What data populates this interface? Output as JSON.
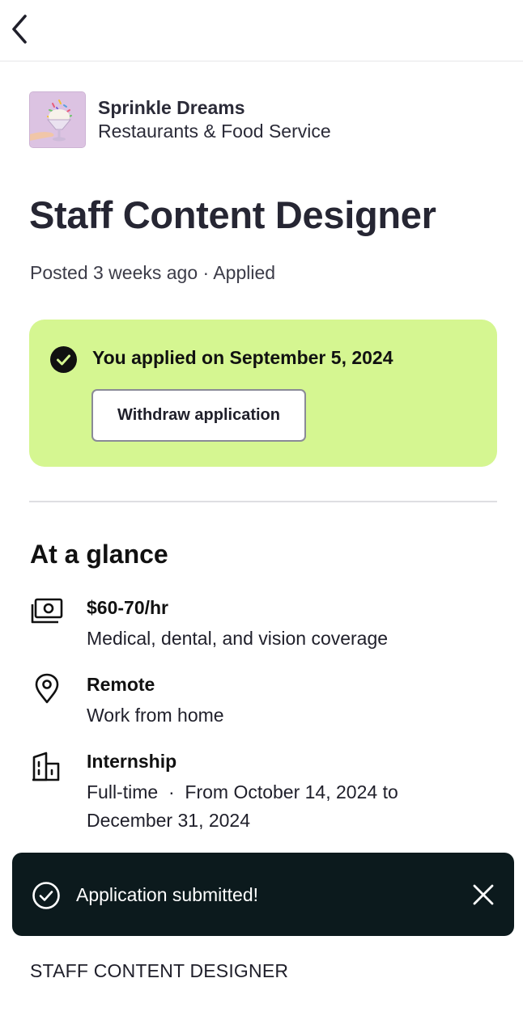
{
  "nav": {
    "back_icon": "chevron-left-icon"
  },
  "company": {
    "logo_icon": "ice-cream-sundae-logo",
    "name": "Sprinkle Dreams",
    "industry": "Restaurants & Food Service"
  },
  "job": {
    "title": "Staff Content Designer",
    "posted": "Posted 3 weeks ago · Applied"
  },
  "application": {
    "status_icon": "check-circle-filled-icon",
    "applied_text": "You applied on September 5, 2024",
    "withdraw_label": "Withdraw application",
    "card_color": "#d5f691"
  },
  "glance": {
    "heading": "At a glance",
    "items": [
      {
        "icon": "money-icon",
        "title": "$60-70/hr",
        "subtitle": "Medical, dental, and vision coverage"
      },
      {
        "icon": "location-pin-icon",
        "title": "Remote",
        "subtitle": "Work from home"
      },
      {
        "icon": "building-icon",
        "title": "Internship",
        "subtitle": "Full-time  ·  From October 14, 2024 to December 31, 2024"
      }
    ]
  },
  "toast": {
    "icon": "check-circle-outline-icon",
    "message": "Application submitted!",
    "close_icon": "close-icon",
    "background": "#0c1a1d"
  },
  "footer": {
    "title_caps": "STAFF CONTENT DESIGNER"
  }
}
